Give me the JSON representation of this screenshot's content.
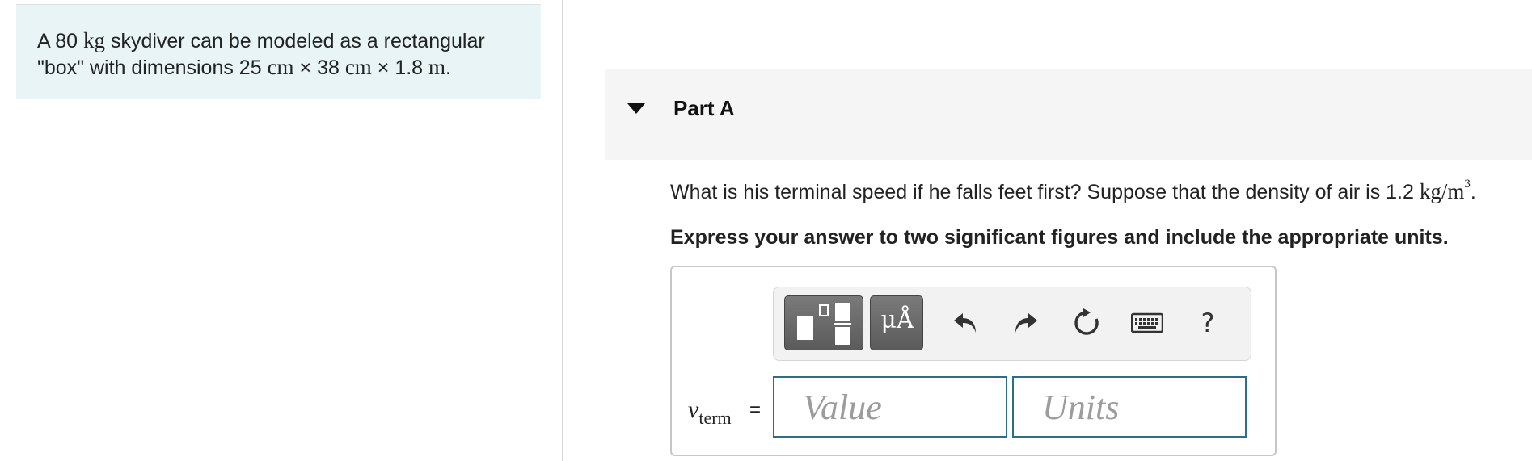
{
  "intro": {
    "line1_pre": "A 80 ",
    "line1_mass_unit": "kg",
    "line1_post": " skydiver can be modeled as a rectangular",
    "line2_pre": "\"box\" with dimensions 25 ",
    "dim1_unit": "cm",
    "times1": " × ",
    "dim2_pre": "38 ",
    "dim2_unit": "cm",
    "times2": " × ",
    "dim3_pre": "1.8 ",
    "dim3_unit": "m",
    "line2_end": "."
  },
  "part": {
    "title": "Part A",
    "question_pre": "What is his terminal speed if he falls feet first? Suppose that the density of air is 1.2 ",
    "density_unit": "kg/m",
    "density_exp": "3",
    "question_end": ".",
    "instruction": "Express your answer to two significant figures and include the appropriate units."
  },
  "toolbar": {
    "units_button_label": "μÅ",
    "icons": [
      "templates-icon",
      "undo-icon",
      "redo-icon",
      "reset-icon",
      "keyboard-icon",
      "help-icon"
    ],
    "help_label": "?"
  },
  "answer": {
    "variable_symbol": "v",
    "variable_subscript": "term",
    "equals": "=",
    "value_placeholder": "Value",
    "units_placeholder": "Units",
    "value": "",
    "units": ""
  },
  "colors": {
    "intro_background": "#e8f4f6",
    "part_header_background": "#f5f5f5",
    "input_border": "#2a6f87",
    "toolbar_button": "#6b6b6b"
  }
}
